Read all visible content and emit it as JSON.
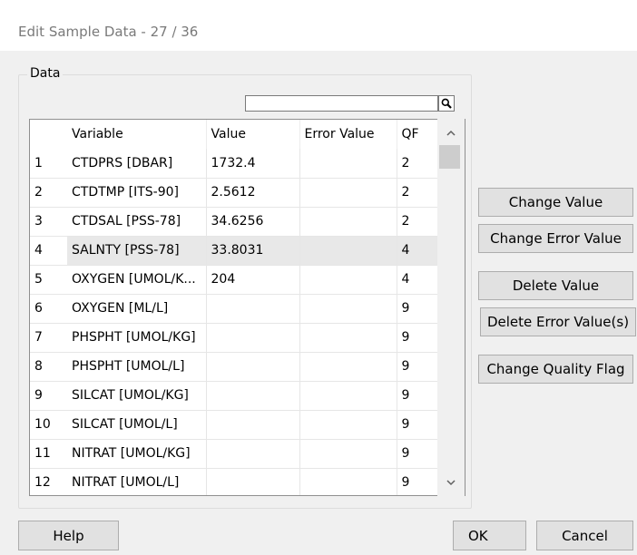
{
  "dialog": {
    "title": "Edit Sample Data - 27 / 36"
  },
  "data_group": {
    "label": "Data"
  },
  "search": {
    "value": "",
    "icon": "search-icon"
  },
  "table": {
    "columns": [
      "",
      "Variable",
      "Value",
      "Error Value",
      "QF"
    ],
    "rows": [
      {
        "num": "1",
        "variable": "CTDPRS [DBAR]",
        "value": "1732.4",
        "error": "",
        "qf": "2"
      },
      {
        "num": "2",
        "variable": "CTDTMP [ITS-90]",
        "value": "2.5612",
        "error": "",
        "qf": "2"
      },
      {
        "num": "3",
        "variable": "CTDSAL [PSS-78]",
        "value": "34.6256",
        "error": "",
        "qf": "2"
      },
      {
        "num": "4",
        "variable": "SALNTY [PSS-78]",
        "value": "33.8031",
        "error": "",
        "qf": "4"
      },
      {
        "num": "5",
        "variable": "OXYGEN [UMOL/K...",
        "value": "204",
        "error": "",
        "qf": "4"
      },
      {
        "num": "6",
        "variable": "OXYGEN [ML/L]",
        "value": "",
        "error": "",
        "qf": "9"
      },
      {
        "num": "7",
        "variable": "PHSPHT [UMOL/KG]",
        "value": "",
        "error": "",
        "qf": "9"
      },
      {
        "num": "8",
        "variable": "PHSPHT [UMOL/L]",
        "value": "",
        "error": "",
        "qf": "9"
      },
      {
        "num": "9",
        "variable": "SILCAT [UMOL/KG]",
        "value": "",
        "error": "",
        "qf": "9"
      },
      {
        "num": "10",
        "variable": "SILCAT [UMOL/L]",
        "value": "",
        "error": "",
        "qf": "9"
      },
      {
        "num": "11",
        "variable": "NITRAT [UMOL/KG]",
        "value": "",
        "error": "",
        "qf": "9"
      },
      {
        "num": "12",
        "variable": "NITRAT [UMOL/L]",
        "value": "",
        "error": "",
        "qf": "9"
      }
    ],
    "selected_row": "4"
  },
  "actions": {
    "change_value": "Change Value",
    "change_error_value": "Change Error Value",
    "delete_value": "Delete Value",
    "delete_error_values": "Delete Error Value(s)",
    "change_quality_flag": "Change Quality Flag"
  },
  "footer": {
    "help": "Help",
    "ok": "OK",
    "cancel": "Cancel"
  }
}
